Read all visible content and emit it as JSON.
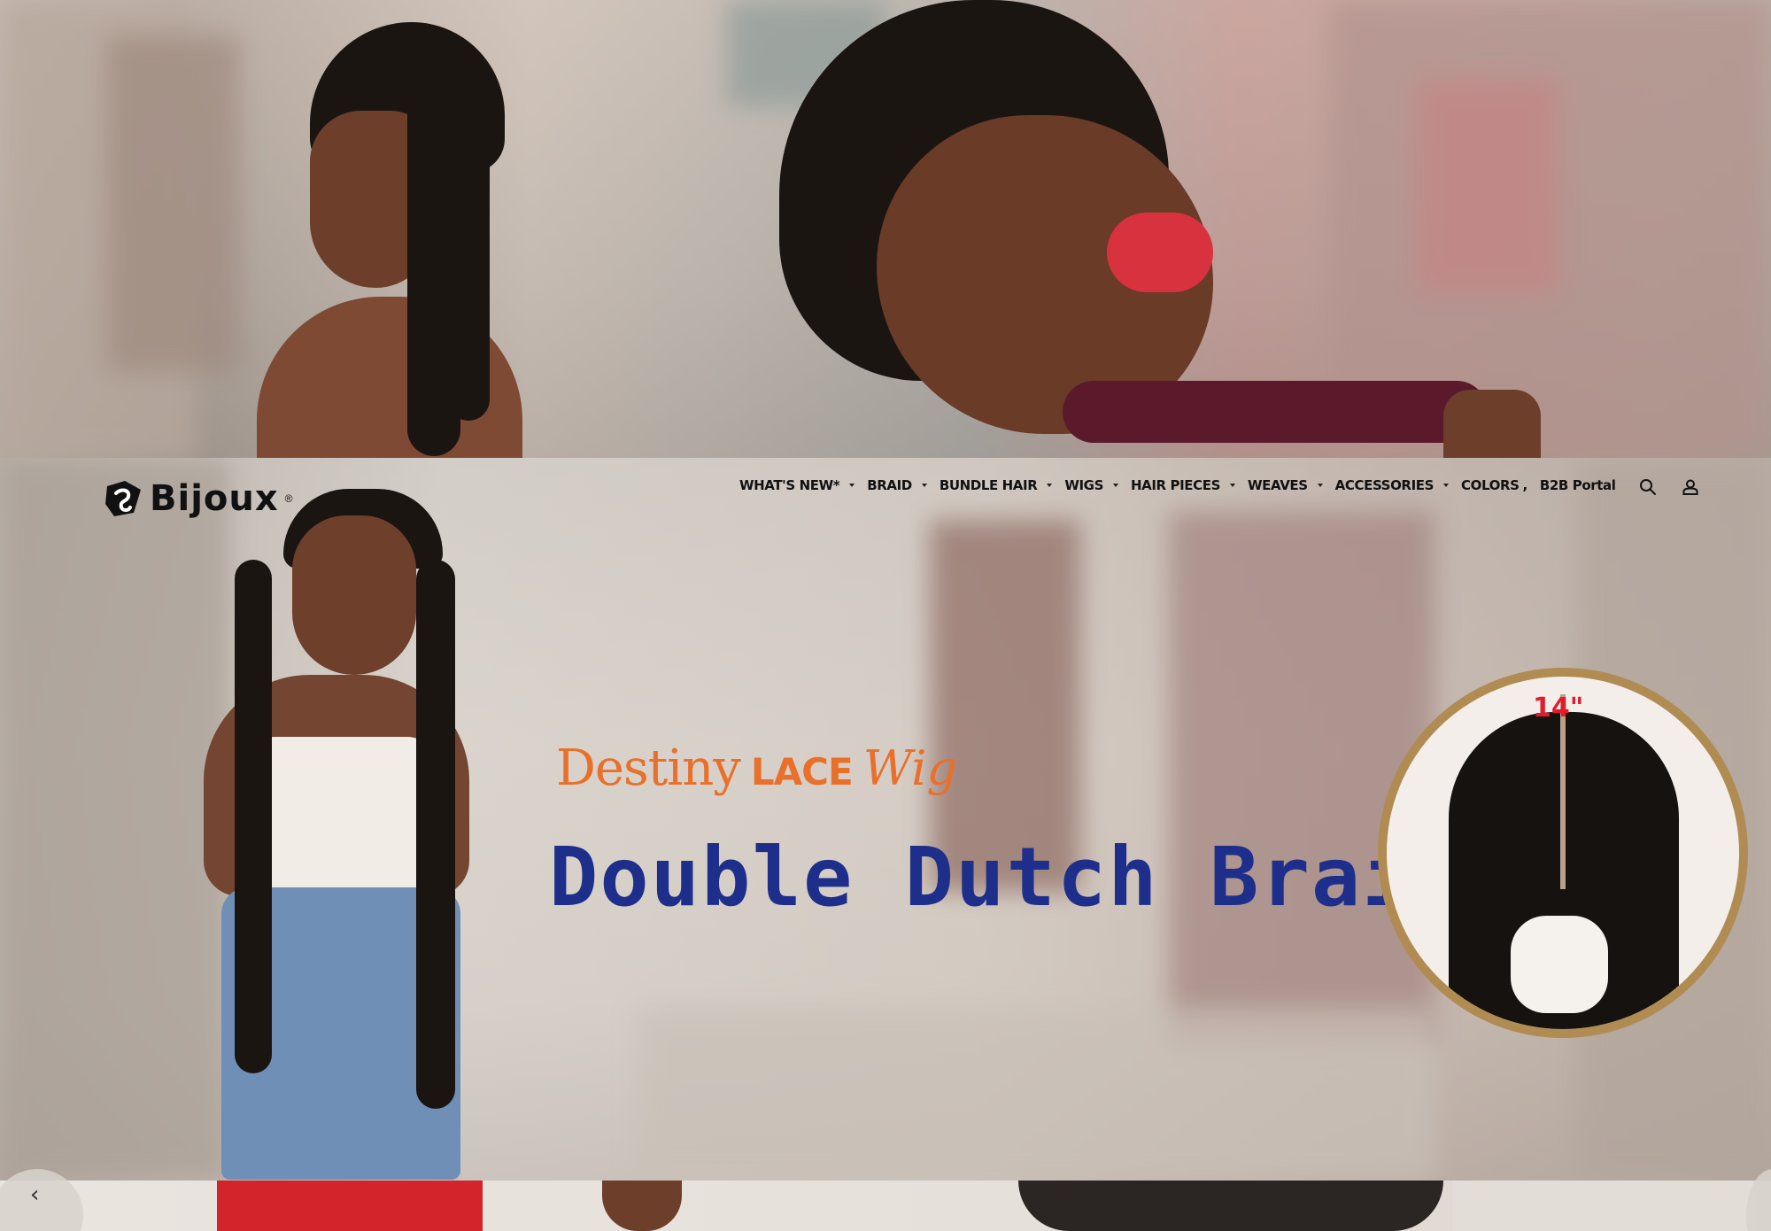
{
  "brand": {
    "logo_text": "Bijoux",
    "logo_reg": "®"
  },
  "nav": {
    "items": [
      {
        "label": "WHAT'S NEW*",
        "has_dropdown": true
      },
      {
        "label": "BRAID",
        "has_dropdown": true
      },
      {
        "label": "BUNDLE HAIR",
        "has_dropdown": true
      },
      {
        "label": "WIGS",
        "has_dropdown": true
      },
      {
        "label": "HAIR PIECES",
        "has_dropdown": true
      },
      {
        "label": "WEAVES",
        "has_dropdown": true
      },
      {
        "label": "ACCESSORIES",
        "has_dropdown": true
      },
      {
        "label": "COLORS",
        "has_dropdown": false
      },
      {
        "label": "B2B Portal",
        "has_dropdown": false
      }
    ],
    "icons": [
      "search-icon",
      "account-icon"
    ]
  },
  "slide": {
    "brand_destiny": "Destiny",
    "brand_destiny_reg": "®",
    "brand_lace": "LACE",
    "brand_wig": "Wig",
    "title": "Double Dutch Braid 40\"",
    "inset_measure": "14\""
  },
  "carousel": {
    "prev_glyph": "‹"
  },
  "colors": {
    "accent_orange": "#e8702a",
    "title_blue": "#1d2f8a",
    "inset_gold": "#b08c52",
    "measure_red": "#e21c2c"
  }
}
